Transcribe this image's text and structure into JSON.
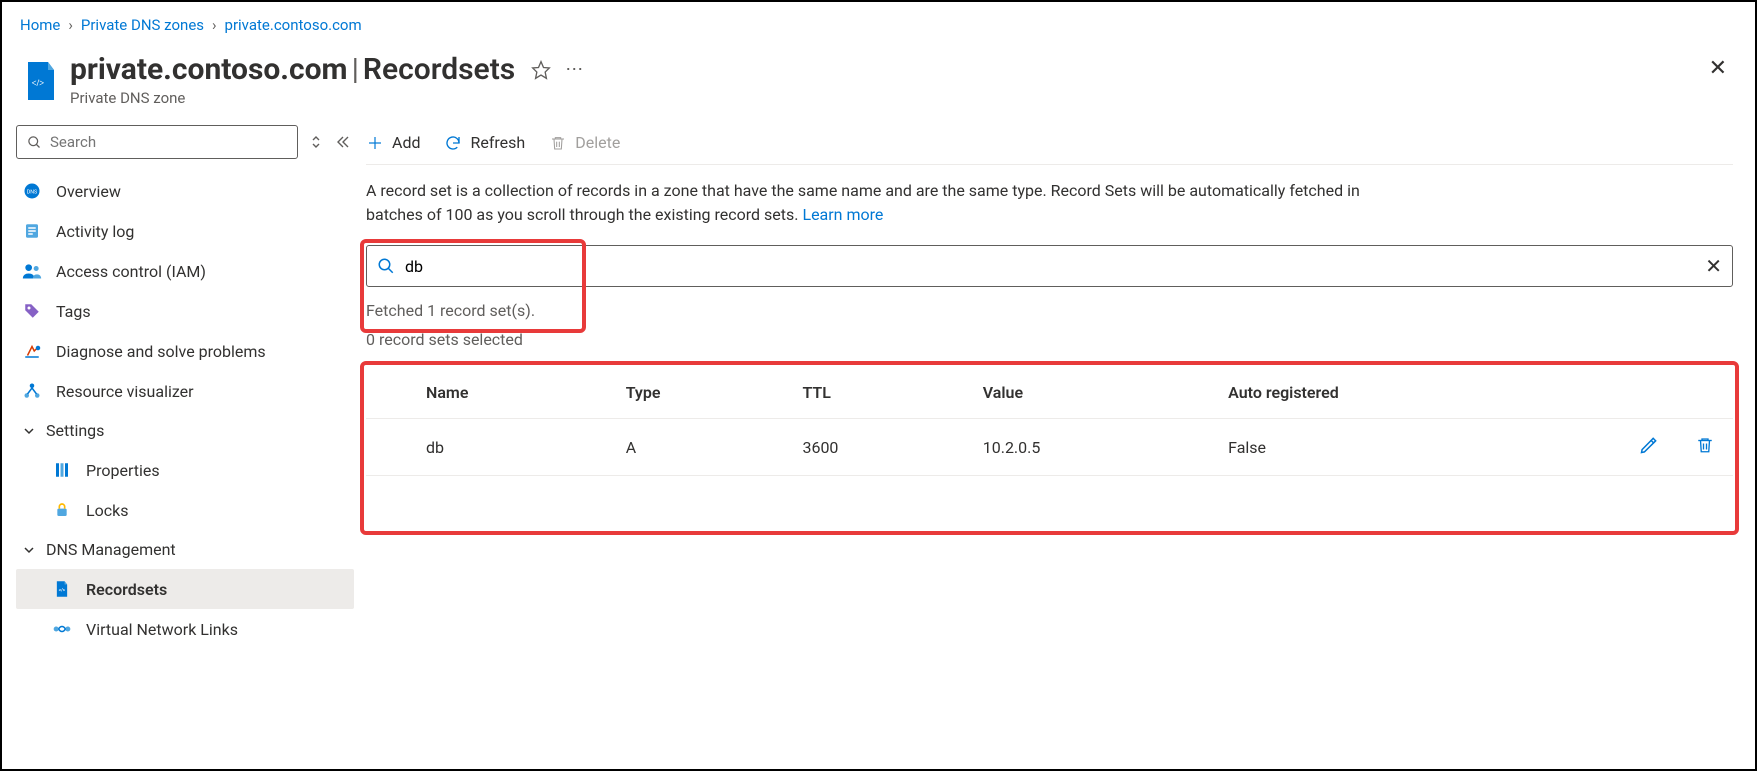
{
  "breadcrumb": {
    "items": [
      "Home",
      "Private DNS zones",
      "private.contoso.com"
    ]
  },
  "header": {
    "title_main": "private.contoso.com",
    "title_suffix": "Recordsets",
    "subtitle": "Private DNS zone"
  },
  "sidebar": {
    "search_placeholder": "Search",
    "items": [
      {
        "label": "Overview",
        "icon": "globe"
      },
      {
        "label": "Activity log",
        "icon": "log"
      },
      {
        "label": "Access control (IAM)",
        "icon": "iam"
      },
      {
        "label": "Tags",
        "icon": "tag"
      },
      {
        "label": "Diagnose and solve problems",
        "icon": "diagnose"
      },
      {
        "label": "Resource visualizer",
        "icon": "visualizer"
      }
    ],
    "groups": [
      {
        "label": "Settings",
        "items": [
          {
            "label": "Properties",
            "icon": "properties"
          },
          {
            "label": "Locks",
            "icon": "lock"
          }
        ]
      },
      {
        "label": "DNS Management",
        "items": [
          {
            "label": "Recordsets",
            "icon": "recordset",
            "selected": true
          },
          {
            "label": "Virtual Network Links",
            "icon": "vnet"
          }
        ]
      }
    ]
  },
  "toolbar": {
    "add_label": "Add",
    "refresh_label": "Refresh",
    "delete_label": "Delete"
  },
  "description": {
    "text": "A record set is a collection of records in a zone that have the same name and are the same type. Record Sets will be automatically fetched in batches of 100 as you scroll through the existing record sets. ",
    "link": "Learn more"
  },
  "filter": {
    "value": "db",
    "fetched_text": "Fetched 1 record set(s).",
    "selected_text": "0 record sets selected"
  },
  "table": {
    "columns": [
      "Name",
      "Type",
      "TTL",
      "Value",
      "Auto registered"
    ],
    "rows": [
      {
        "name": "db",
        "type": "A",
        "ttl": "3600",
        "value": "10.2.0.5",
        "auto": "False"
      }
    ]
  }
}
